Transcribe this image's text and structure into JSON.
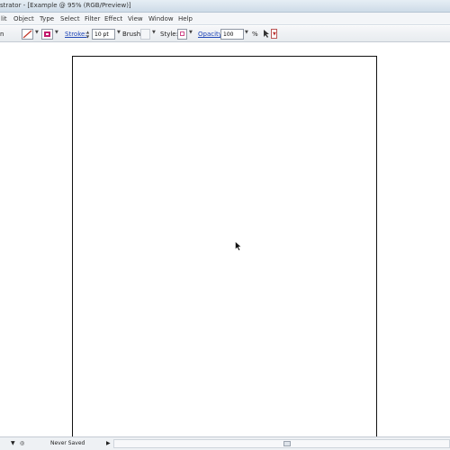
{
  "titlebar": {
    "title": "strator - [Example @ 95% (RGB/Preview)]"
  },
  "menu": [
    "lit",
    "Object",
    "Type",
    "Select",
    "Filter",
    "Effect",
    "View",
    "Window",
    "Help"
  ],
  "controlbar": {
    "partial_label": "n",
    "stroke_label": "Stroke:",
    "stroke_value": "10 pt",
    "brush_label": "Brush:",
    "style_label": "Style:",
    "opacity_label": "Opacity:",
    "opacity_value": "100",
    "percent": "%"
  },
  "colors": {
    "fill_swatch_border": "#c2186b",
    "stroke_slash": "#c0392b"
  },
  "statusbar": {
    "save_status": "Never Saved"
  }
}
